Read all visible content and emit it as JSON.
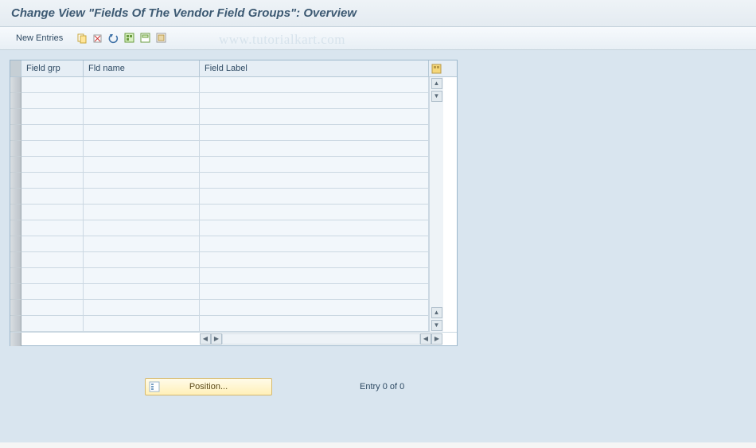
{
  "title": "Change View \"Fields Of The Vendor Field Groups\": Overview",
  "toolbar": {
    "new_entries": "New Entries",
    "icons": {
      "copy": "copy",
      "delete": "delete",
      "undo": "undo",
      "select_all": "select-all",
      "select_block": "select-block",
      "deselect": "deselect"
    }
  },
  "watermark": "www.tutorialkart.com",
  "table": {
    "columns": {
      "field_grp": "Field grp",
      "fld_name": "Fld name",
      "field_label": "Field Label"
    },
    "row_count": 16
  },
  "footer": {
    "position_label": "Position...",
    "entry_text": "Entry 0 of 0"
  }
}
